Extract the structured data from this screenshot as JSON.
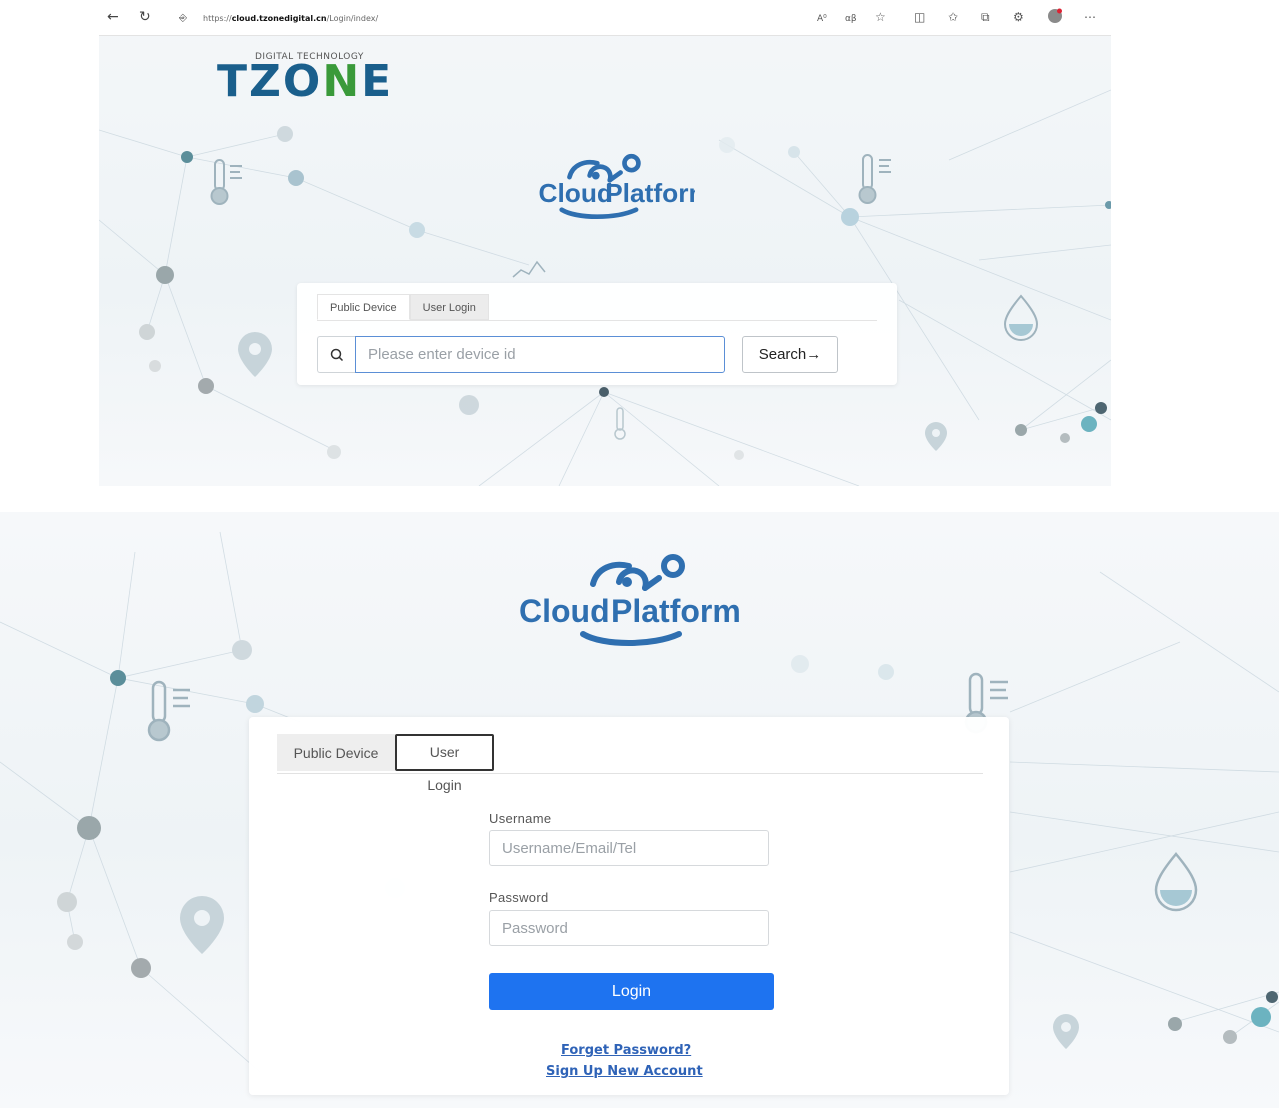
{
  "browser": {
    "url_prefix": "https://",
    "url_host": "cloud.tzonedigital.cn",
    "url_path": "/Login/index/"
  },
  "brand": {
    "tagline": "DIGITAL TECHNOLOGY",
    "logo_text_a": "TZO",
    "logo_text_n": "N",
    "logo_text_b": "E"
  },
  "platform": {
    "title_word_1": "Cloud",
    "title_word_2": "Platform"
  },
  "search_panel": {
    "tabs": [
      {
        "label": "Public Device",
        "active": true
      },
      {
        "label": "User Login",
        "active": false
      }
    ],
    "input_placeholder": "Please enter device id",
    "search_label": "Search→"
  },
  "login_panel": {
    "tabs": [
      {
        "label": "Public Device",
        "active": false
      },
      {
        "label": "User Login",
        "active": true
      }
    ],
    "username_label": "Username",
    "username_placeholder": "Username/Email/Tel",
    "password_label": "Password",
    "password_placeholder": "Password",
    "login_label": "Login",
    "forget_password": "Forget Password?",
    "sign_up": "Sign Up New Account"
  },
  "colors": {
    "brand_blue": "#1a5f8c",
    "brand_green": "#3a9a3a",
    "primary_button": "#1e73f0",
    "link": "#2f63b7",
    "cloud_logo": "#2f6fb0"
  }
}
